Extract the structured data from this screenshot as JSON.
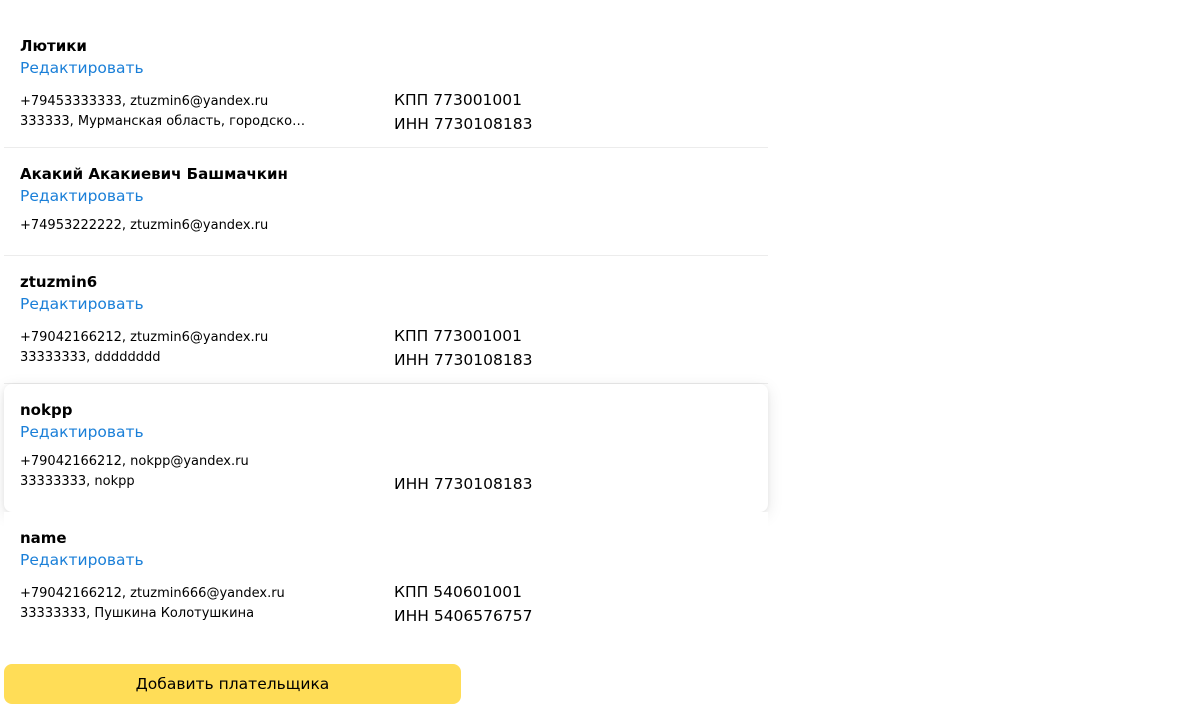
{
  "payers": [
    {
      "name": "Лютики",
      "edit_label": "Редактировать",
      "contacts": "+79453333333, ztuzmin6@yandex.ru",
      "address": "333333, Мурманская область, городской...",
      "kpp": "КПП 773001001",
      "inn": "ИНН 7730108183"
    },
    {
      "name": "Акакий Акакиевич Башмачкин",
      "edit_label": "Редактировать",
      "contacts": "+74953222222, ztuzmin6@yandex.ru",
      "address": "",
      "kpp": "",
      "inn": ""
    },
    {
      "name": "ztuzmin6",
      "edit_label": "Редактировать",
      "contacts": "+79042166212, ztuzmin6@yandex.ru",
      "address": "33333333, dddddddd",
      "kpp": "КПП 773001001",
      "inn": "ИНН 7730108183"
    },
    {
      "name": "nokpp",
      "edit_label": "Редактировать",
      "contacts": "+79042166212, nokpp@yandex.ru",
      "address": "33333333, nokpp",
      "kpp": "",
      "inn": "ИНН 7730108183"
    },
    {
      "name": "name",
      "edit_label": "Редактировать",
      "contacts": "+79042166212, ztuzmin666@yandex.ru",
      "address": "33333333, Пушкина Колотушкина",
      "kpp": "КПП 540601001",
      "inn": "ИНН 5406576757"
    }
  ],
  "add_button_label": "Добавить плательщика",
  "colors": {
    "link": "#1a7fd8",
    "button_bg": "#ffdd57",
    "divider": "#ececec"
  }
}
